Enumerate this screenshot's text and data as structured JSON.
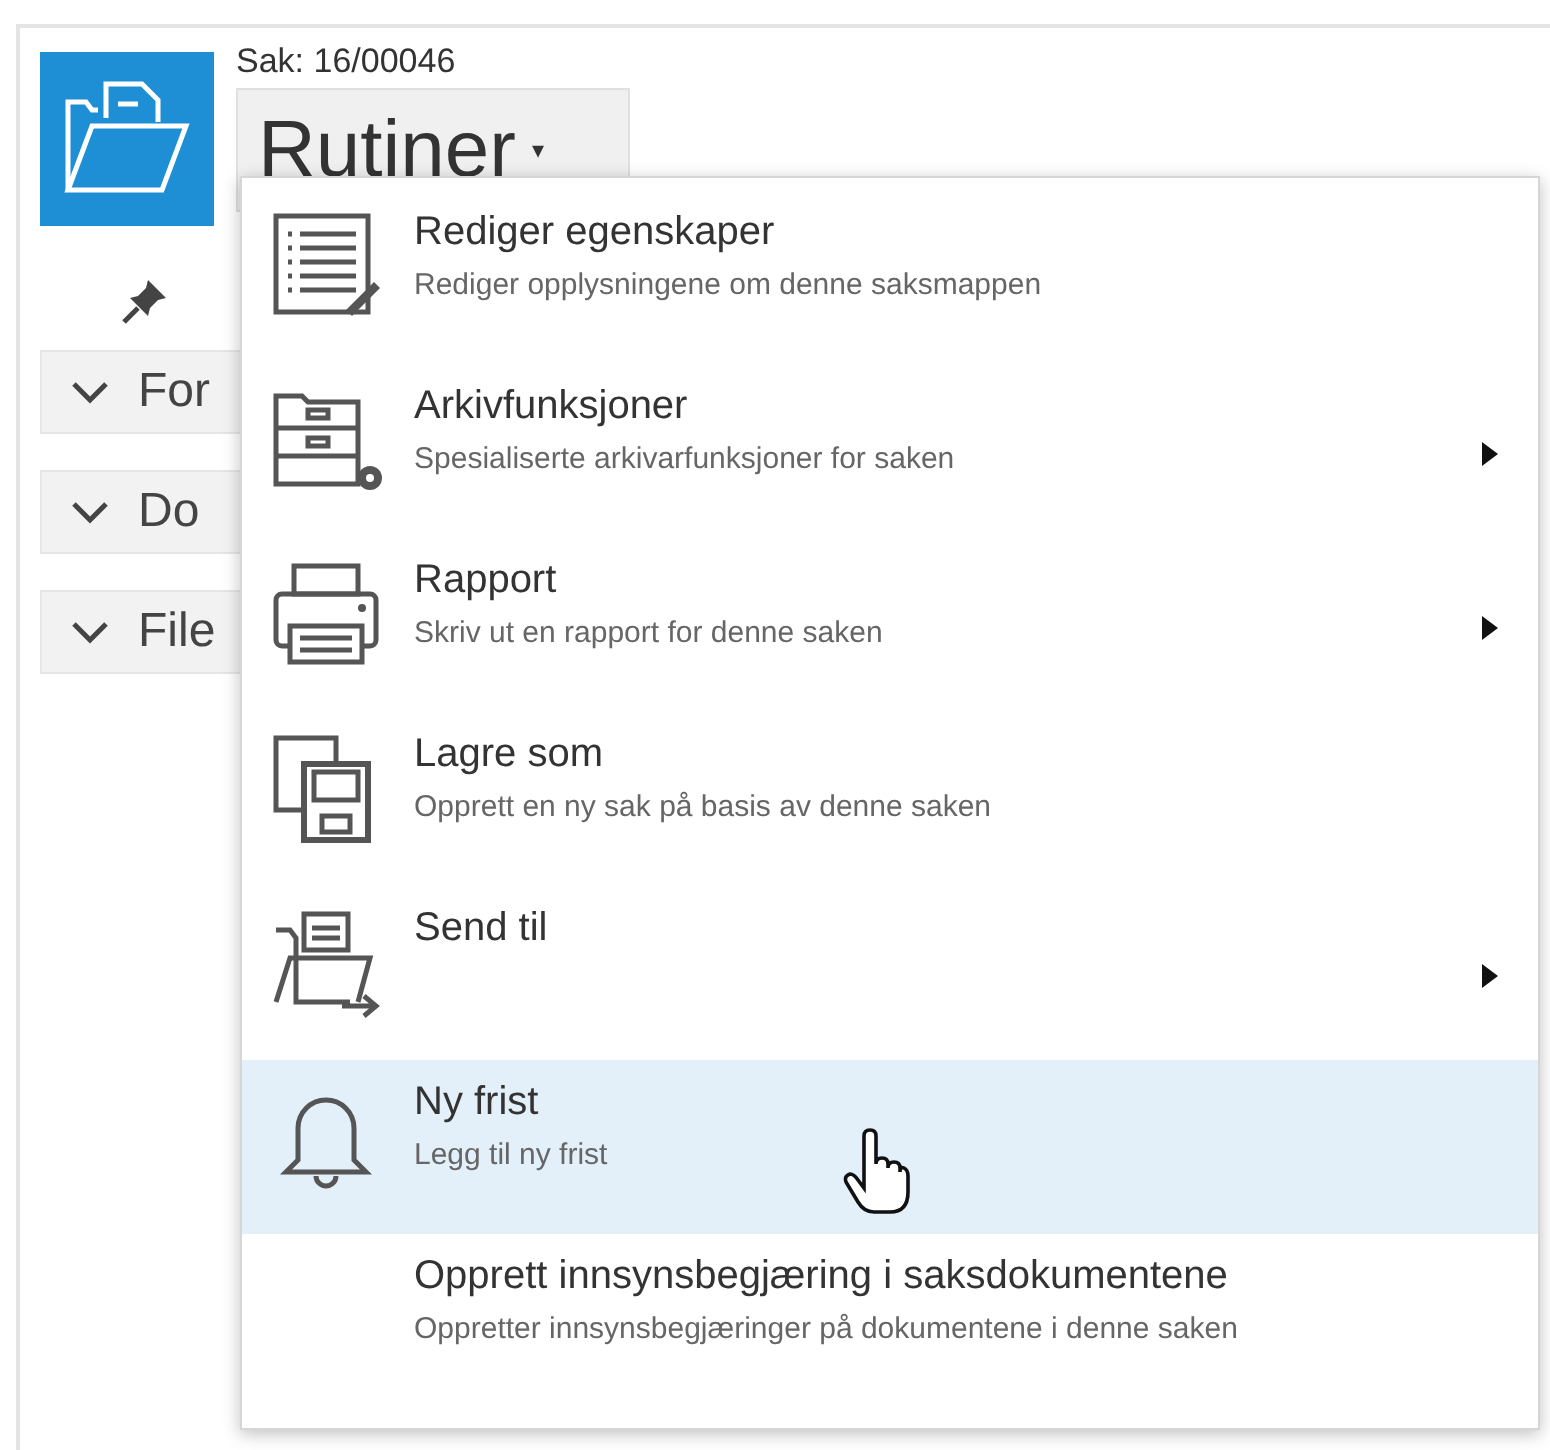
{
  "case_label": "Sak: 16/00046",
  "routines_button": {
    "label": "Rutiner",
    "caret": "▾"
  },
  "sections": [
    {
      "label": "For",
      "expanded": false
    },
    {
      "label": "Do",
      "expanded": false
    },
    {
      "label": "File",
      "expanded": false
    }
  ],
  "menu": {
    "items": [
      {
        "title": "Rediger egenskaper",
        "description": "Rediger opplysningene om denne saksmappen",
        "submenu": false,
        "selected": false
      },
      {
        "title": "Arkivfunksjoner",
        "description": "Spesialiserte arkivarfunksjoner for saken",
        "submenu": true,
        "selected": false
      },
      {
        "title": "Rapport",
        "description": "Skriv ut en rapport for denne saken",
        "submenu": true,
        "selected": false
      },
      {
        "title": "Lagre som",
        "description": "Opprett en ny sak på basis av denne saken",
        "submenu": false,
        "selected": false
      },
      {
        "title": "Send til",
        "submenu": true,
        "selected": false
      },
      {
        "title": "Ny frist",
        "description": "Legg til ny frist",
        "submenu": false,
        "selected": true
      },
      {
        "title": "Opprett innsynsbegjæring i saksdokumentene",
        "description": "Oppretter innsynsbegjæringer på dokumentene i denne saken",
        "submenu": false,
        "selected": false
      }
    ]
  }
}
